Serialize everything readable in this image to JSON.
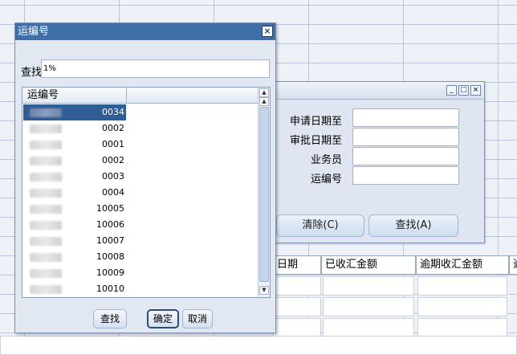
{
  "popup": {
    "title": "运编号",
    "find_label": "查找",
    "find_value": "1%",
    "column_header": "运编号",
    "rows": [
      {
        "suffix": "0034",
        "selected": true
      },
      {
        "suffix": "0002",
        "selected": false
      },
      {
        "suffix": "0001",
        "selected": false
      },
      {
        "suffix": "0002",
        "selected": false
      },
      {
        "suffix": "0003",
        "selected": false
      },
      {
        "suffix": "0004",
        "selected": false
      },
      {
        "suffix": "10005",
        "selected": false
      },
      {
        "suffix": "10006",
        "selected": false
      },
      {
        "suffix": "10007",
        "selected": false
      },
      {
        "suffix": "10008",
        "selected": false
      },
      {
        "suffix": "10009",
        "selected": false
      },
      {
        "suffix": "10010",
        "selected": false
      }
    ],
    "buttons": {
      "find": "查找",
      "ok": "确定",
      "cancel": "取消"
    }
  },
  "search_window": {
    "fields": [
      {
        "label": "申请日期至"
      },
      {
        "label": "审批日期至"
      },
      {
        "label": "业务员"
      },
      {
        "label": "运编号"
      }
    ],
    "buttons": {
      "clear": "清除(C)",
      "find": "查找(A)"
    }
  },
  "table": {
    "headers": [
      "日期",
      "已收汇金额",
      "逾期收汇金额",
      "逾"
    ]
  },
  "colors": {
    "popup_title_bg": "#3e6fa8",
    "selected_row_bg": "#2f5d95",
    "panel_bg": "#e2e8f1"
  }
}
